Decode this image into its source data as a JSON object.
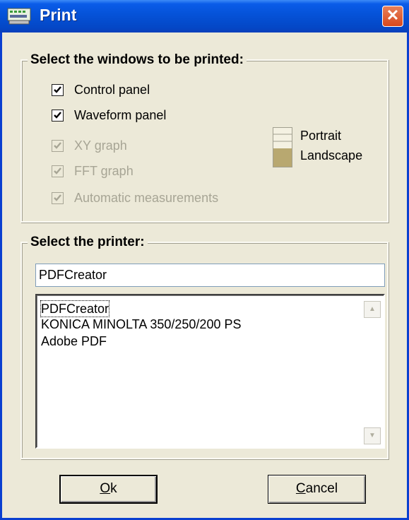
{
  "window": {
    "title": "Print",
    "close_glyph": "✕",
    "title_icon": "printer-app-icon"
  },
  "windows_group": {
    "legend": "Select the windows to be printed:",
    "checkboxes": [
      {
        "label": "Control panel",
        "checked": true,
        "enabled": true
      },
      {
        "label": "Waveform panel",
        "checked": true,
        "enabled": true
      },
      {
        "label": "XY graph",
        "checked": true,
        "enabled": false
      },
      {
        "label": "FFT graph",
        "checked": true,
        "enabled": false
      },
      {
        "label": "Automatic measurements",
        "checked": true,
        "enabled": false
      }
    ],
    "orientation": {
      "options": [
        "Portrait",
        "Landscape"
      ],
      "selected": "Landscape",
      "icon": "orientation-toggle-icon"
    }
  },
  "printer_group": {
    "legend": "Select the printer:",
    "selected_printer": "PDFCreator",
    "printers": [
      "PDFCreator",
      "KONICA MINOLTA 350/250/200 PS",
      "Adobe PDF"
    ]
  },
  "buttons": {
    "ok_label_underlined": "O",
    "ok_label_rest": "k",
    "cancel_label_underlined": "C",
    "cancel_label_rest": "ancel"
  },
  "colors": {
    "title_bar": "#0552d8",
    "dialog_bg": "#ece9d8",
    "close_button": "#d8481c",
    "disabled_text": "#a7a595",
    "orientation_fill": "#b8a870"
  }
}
